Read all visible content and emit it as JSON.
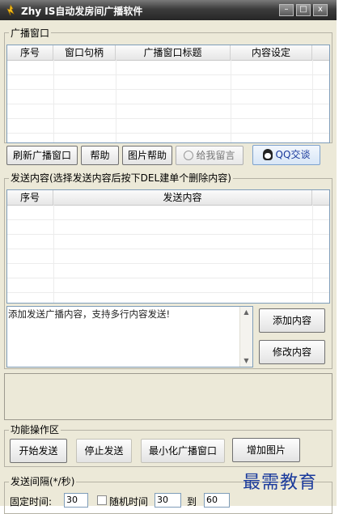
{
  "window": {
    "title": "Zhy IS自动发房间广播软件",
    "controls": {
      "minimize": "–",
      "maximize": "□",
      "close": "x"
    }
  },
  "broadcast_window_group": {
    "label": "广播窗口",
    "columns": [
      "序号",
      "窗口句柄",
      "广播窗口标题",
      "内容设定"
    ],
    "rows": []
  },
  "toolbar": {
    "refresh": "刷新广播窗口",
    "help": "帮助",
    "image_help": "图片帮助",
    "leave_message": "给我留言",
    "qq": "QQ交谈"
  },
  "send_content_group": {
    "label": "发送内容(选择发送内容后按下DEL建单个删除内容)",
    "columns": [
      "序号",
      "发送内容"
    ],
    "rows": []
  },
  "editor": {
    "placeholder_text": "添加发送广播内容，支持多行内容发送!",
    "add_button": "添加内容",
    "modify_button": "修改内容"
  },
  "function_group": {
    "label": "功能操作区",
    "start": "开始发送",
    "stop": "停止发送",
    "minimize": "最小化广播窗口",
    "add_image": "增加图片"
  },
  "interval_group": {
    "label": "发送间隔(*/秒)",
    "fixed_label": "固定时间:",
    "fixed_value": "30",
    "random_label": "随机时间",
    "random_from": "30",
    "to_label": "到",
    "random_to": "60"
  },
  "watermark": "最需教育",
  "colors": {
    "titlebar": "#3c3c3c",
    "face": "#ece9d8",
    "list_border": "#7f9db9",
    "qq_highlight": "#1a3a9c"
  }
}
